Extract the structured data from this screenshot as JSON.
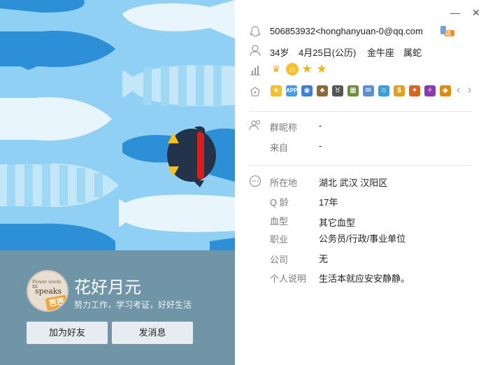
{
  "profile": {
    "nickname": "花好月元",
    "signature": "努力工作，学习考证，好好生活",
    "avatar_text_small": "Flower words fill",
    "avatar_text": "speaks",
    "avatar_badge": "芭芭",
    "add_friend_label": "加为好友",
    "send_message_label": "发消息"
  },
  "window": {
    "minimize": "—",
    "close": "✕"
  },
  "account": {
    "qq_email": "506853932<honghanyuan-0@qq.com",
    "vip_badge": "达人",
    "age": "34岁",
    "birthday": "4月25日(公历)",
    "constellation": "金牛座",
    "zodiac": "属蛇"
  },
  "level_icons": [
    "crown-icon",
    "sun-icon",
    "star-icon",
    "star-icon"
  ],
  "service_icons": [
    "star-app-icon",
    "app-icon",
    "photo-icon",
    "plant-icon",
    "cow-icon",
    "game-icon",
    "mail-icon",
    "pet-icon",
    "coin-icon",
    "medal-icon",
    "wand-icon",
    "shield-icon"
  ],
  "nav": {
    "prev": "‹",
    "next": "›"
  },
  "group": {
    "group_nickname_label": "群昵称",
    "group_nickname_value": "-",
    "from_label": "来自",
    "from_value": "-"
  },
  "details": {
    "location_label": "所在地",
    "location_value": "湖北 武汉 汉阳区",
    "qage_label": "Q 龄",
    "qage_value": "17年",
    "blood_label": "血型",
    "blood_value": "其它血型",
    "job_label": "职业",
    "job_value": "公务员/行政/事业单位",
    "company_label": "公司",
    "company_value": "无",
    "bio_label": "个人说明",
    "bio_value": "生活本就应安安静静。"
  },
  "colors": {
    "banner_bg": "#8fd0f4",
    "profile_panel": "#6f95a6",
    "fish_blue": "#2d8fd5",
    "fish_white": "#e9f5fc",
    "penguin": "#233349",
    "scarf": "#d81e1e"
  }
}
